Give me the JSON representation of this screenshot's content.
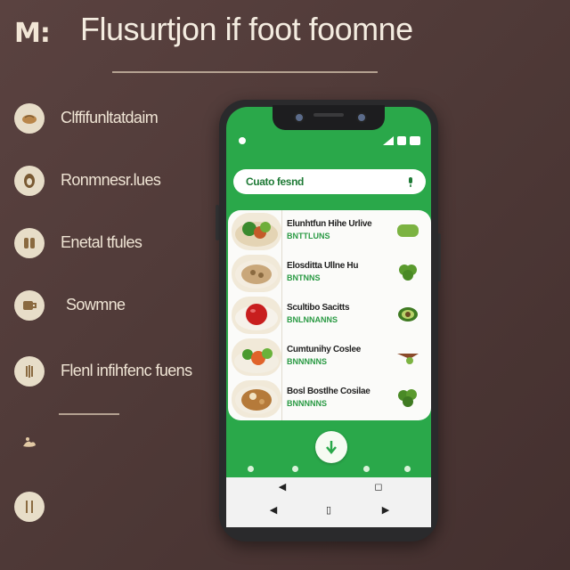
{
  "header": {
    "logo_text": "M:",
    "title": "Flusurtjon if foot foomne"
  },
  "menu": [
    {
      "label": "Clffifunltatdaim",
      "icon": "bread-icon"
    },
    {
      "label": "Ronmnesr.lues",
      "icon": "egg-icon"
    },
    {
      "label": "Enetal tfules",
      "icon": "grain-icon"
    },
    {
      "label": "Sowmne",
      "icon": "cup-icon"
    },
    {
      "label": "Flenl infihfenc fuens",
      "icon": "apple-icon"
    },
    {
      "label": "",
      "icon": "rabbit-icon"
    },
    {
      "label": "",
      "icon": "fork-icon"
    }
  ],
  "phone": {
    "status_time": "",
    "search": {
      "text": "Cuato fesnd"
    },
    "list": [
      {
        "title": "Elunhtfun Hihe Urlive",
        "subtitle": "BNTTLUNS",
        "thumb": "salad-bowl",
        "icon": "green-pepper-icon"
      },
      {
        "title": "Elosditta Ullne Hu",
        "subtitle": "BNTNNS",
        "thumb": "soup-bowl",
        "icon": "broccoli-icon"
      },
      {
        "title": "Scultibo Sacitts",
        "subtitle": "BNLNNANNS",
        "thumb": "tomato",
        "icon": "avocado-icon"
      },
      {
        "title": "Cumtunihy Coslee",
        "subtitle": "BNNNNNS",
        "thumb": "vegetable-plate",
        "icon": "carrot-icon"
      },
      {
        "title": "Bosl Bostlhe Cosilae",
        "subtitle": "BNNNNNS",
        "thumb": "stew-bowl",
        "icon": "kale-icon"
      }
    ]
  },
  "colors": {
    "background": "#4d3836",
    "accent": "#2aa84a",
    "menu_icon_bg": "#e7ddc8"
  }
}
